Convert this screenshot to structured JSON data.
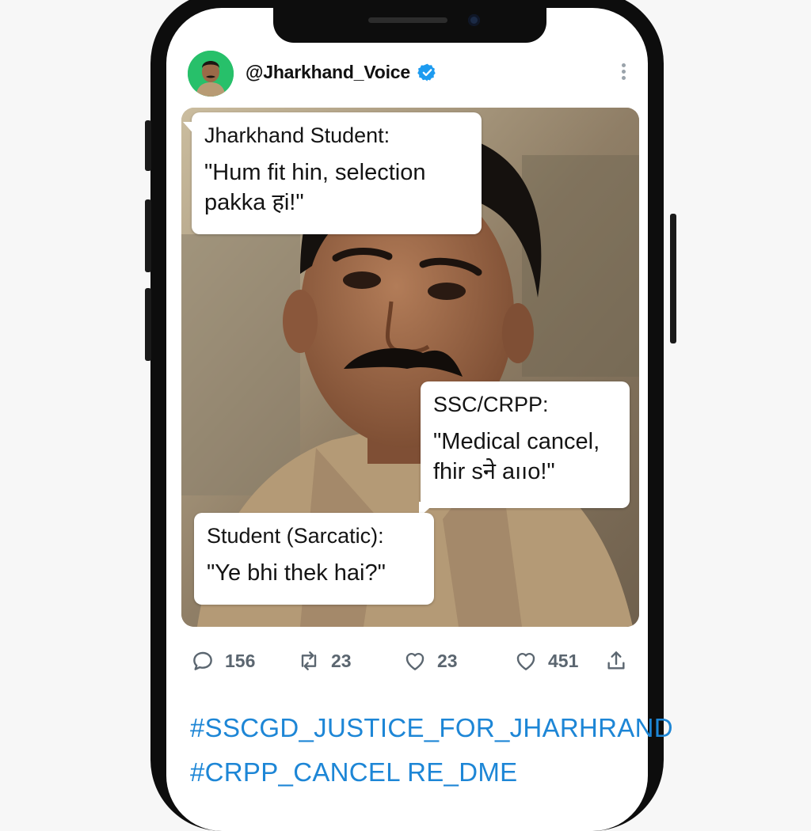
{
  "post": {
    "handle": "@Jharkhand_Voice",
    "verified_color": "#1d9bf0"
  },
  "meme": {
    "bubble1": {
      "speaker": "Jharkhand Student:",
      "line1": "\"Hum fit hin, selection",
      "line2": "pakka हi!\""
    },
    "bubble2": {
      "speaker": "SSC/CRPP:",
      "line1": "\"Medical cancel,",
      "line2": "fhir sने aııo!\""
    },
    "bubble3": {
      "speaker": "Student (Sarcatic):",
      "line1": "\"Ye bhi thek hai?\""
    }
  },
  "actions": {
    "replies": "156",
    "retweets": "23",
    "likes": "23",
    "views": "451"
  },
  "hashtags": [
    "#SSCGD_JUSTICE_FOR_JHARHRAND",
    "#CRPP_CANCEL RE_DME"
  ],
  "icons": [
    "verified-badge-icon",
    "more-options-icon",
    "reply-icon",
    "retweet-icon",
    "like-icon",
    "share-icon"
  ],
  "colors": {
    "accent": "#1d86d6",
    "avatar_bg": "#27c06a"
  }
}
